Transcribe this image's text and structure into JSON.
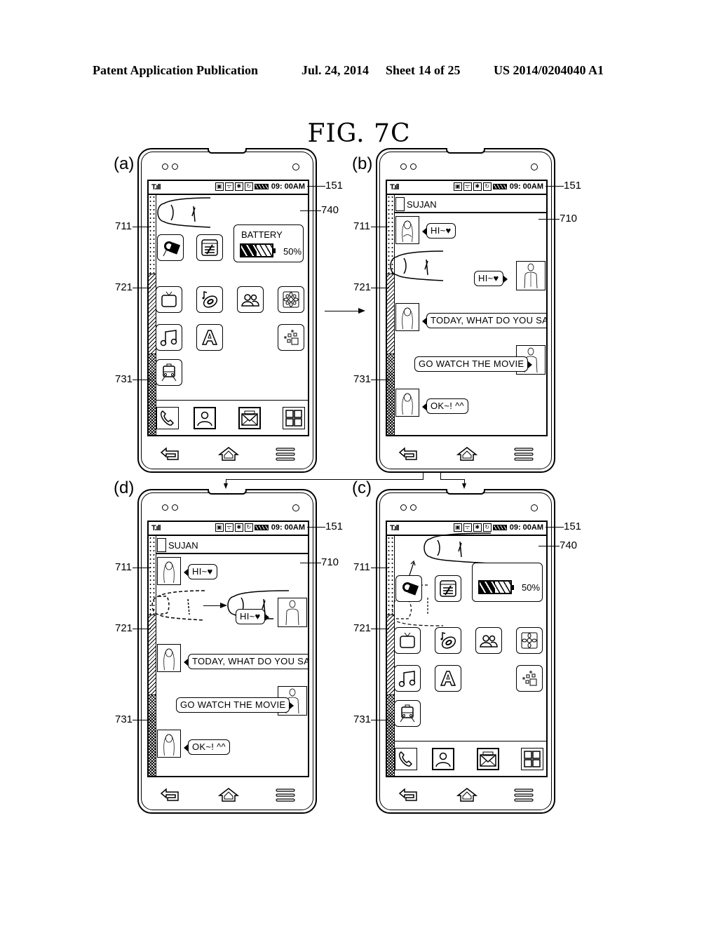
{
  "header": {
    "publication": "Patent Application Publication",
    "date": "Jul. 24, 2014",
    "sheet": "Sheet 14 of 25",
    "number": "US 2014/0204040 A1"
  },
  "figure": {
    "title": "FIG.  7C"
  },
  "status_bar": {
    "signal_icon": "signal-bars-icon",
    "icons": [
      "sim-icon",
      "wifi-icon",
      "bluetooth-icon",
      "sync-icon"
    ],
    "battery_icon": "battery-icon",
    "time": "09: 00AM"
  },
  "reference_numerals": {
    "display": "151",
    "home_screen": "740",
    "chat_screen": "710",
    "first_area": "711",
    "second_area": "721",
    "third_area": "731"
  },
  "panels": {
    "a": {
      "label": "(a)",
      "screen": "home",
      "battery_widget": {
        "label": "BATTERY",
        "percent_text": "50%",
        "level": 0.5
      }
    },
    "b": {
      "label": "(b)",
      "screen": "chat"
    },
    "c": {
      "label": "(c)",
      "screen": "home",
      "battery_widget": {
        "label": "",
        "percent_text": "50%",
        "level": 0.5
      }
    },
    "d": {
      "label": "(d)",
      "screen": "chat"
    }
  },
  "home_screen": {
    "row1_apps": [
      "camera-app-icon",
      "memo-app-icon"
    ],
    "row2_apps": [
      "tv-app-icon",
      "music-disc-app-icon",
      "contacts-group-app-icon",
      "gallery-flower-app-icon"
    ],
    "row3_apps": [
      "music-note-app-icon",
      "font-a-app-icon",
      "widgets-app-icon"
    ],
    "row4_apps": [
      "subway-app-icon"
    ],
    "dock": [
      "phone-icon",
      "contact-card-icon",
      "message-envelope-icon",
      "apps-grid-icon"
    ]
  },
  "chat": {
    "contact_name": "SUJAN",
    "messages": [
      {
        "side": "left",
        "text": "HI~♥"
      },
      {
        "side": "right",
        "text": "HI~♥"
      },
      {
        "side": "left",
        "text": "TODAY, WHAT DO YOU SAY?"
      },
      {
        "side": "right",
        "text": "GO WATCH THE MOVIE"
      },
      {
        "side": "left",
        "text": "OK~! ^^"
      }
    ]
  },
  "navigation": [
    "back-icon",
    "home-icon",
    "menu-icon"
  ]
}
